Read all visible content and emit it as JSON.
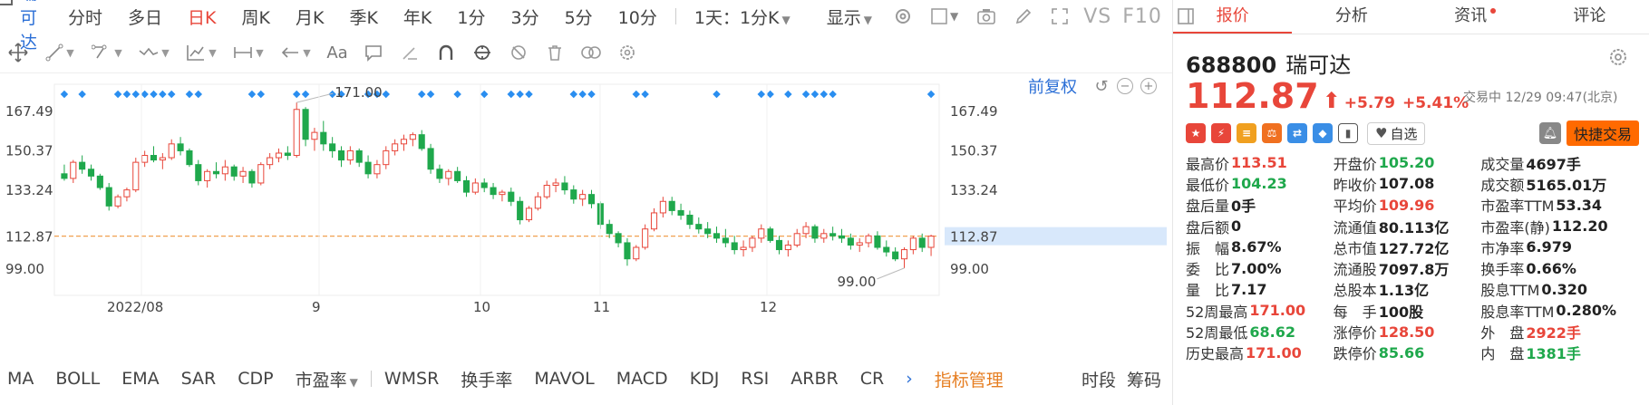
{
  "topbar": {
    "stock_name": "瑞可达",
    "timeframes": [
      {
        "label": "分时",
        "active": false
      },
      {
        "label": "多日",
        "active": false
      },
      {
        "label": "日K",
        "active": true
      },
      {
        "label": "周K",
        "active": false
      },
      {
        "label": "月K",
        "active": false
      },
      {
        "label": "季K",
        "active": false
      },
      {
        "label": "年K",
        "active": false
      },
      {
        "label": "1分",
        "active": false
      },
      {
        "label": "3分",
        "active": false
      },
      {
        "label": "5分",
        "active": false
      },
      {
        "label": "10分",
        "active": false
      }
    ],
    "range_select": "1天：1分K",
    "display_label": "显示",
    "vs_label": "VS",
    "f10_label": "F10"
  },
  "chart": {
    "adjust_label": "前复权",
    "date_labels": [
      "2022/08",
      "9",
      "10",
      "11",
      "12"
    ],
    "y_ticks": [
      "167.49",
      "150.37",
      "133.24",
      "112.87",
      "99.00"
    ],
    "y_ticks_right": [
      "167.49",
      "150.37",
      "133.24",
      "112.87",
      "99.00"
    ],
    "high_annotation": "171.00",
    "low_annotation": "99.00",
    "current_price_label": "112.87"
  },
  "chart_data": {
    "type": "candlestick",
    "ylim": [
      90,
      180
    ],
    "current_price": 112.87,
    "high": 171.0,
    "low": 99.0,
    "x_labels": [
      "2022/08",
      "9",
      "10",
      "11",
      "12"
    ],
    "candles": [
      [
        140,
        144,
        137,
        138
      ],
      [
        138,
        146,
        136,
        145
      ],
      [
        145,
        148,
        140,
        142
      ],
      [
        142,
        144,
        137,
        139
      ],
      [
        139,
        140,
        133,
        134
      ],
      [
        134,
        136,
        124,
        126
      ],
      [
        126,
        131,
        125,
        130
      ],
      [
        130,
        134,
        128,
        133
      ],
      [
        133,
        147,
        132,
        145
      ],
      [
        145,
        150,
        143,
        148
      ],
      [
        148,
        152,
        145,
        146
      ],
      [
        146,
        149,
        142,
        147
      ],
      [
        147,
        155,
        146,
        153
      ],
      [
        153,
        156,
        148,
        150
      ],
      [
        150,
        151,
        143,
        144
      ],
      [
        144,
        146,
        135,
        137
      ],
      [
        137,
        142,
        134,
        141
      ],
      [
        141,
        145,
        138,
        140
      ],
      [
        140,
        146,
        137,
        143
      ],
      [
        143,
        144,
        137,
        139
      ],
      [
        139,
        143,
        136,
        141
      ],
      [
        141,
        142,
        134,
        136
      ],
      [
        136,
        145,
        135,
        144
      ],
      [
        144,
        149,
        142,
        147
      ],
      [
        147,
        151,
        145,
        149
      ],
      [
        149,
        152,
        146,
        148
      ],
      [
        148,
        171,
        147,
        168
      ],
      [
        168,
        169,
        152,
        155
      ],
      [
        155,
        160,
        150,
        158
      ],
      [
        158,
        163,
        150,
        153
      ],
      [
        153,
        156,
        147,
        150
      ],
      [
        150,
        152,
        143,
        146
      ],
      [
        146,
        152,
        144,
        150
      ],
      [
        150,
        151,
        143,
        145
      ],
      [
        145,
        148,
        138,
        140
      ],
      [
        140,
        146,
        138,
        144
      ],
      [
        144,
        152,
        142,
        150
      ],
      [
        150,
        155,
        148,
        153
      ],
      [
        153,
        157,
        150,
        155
      ],
      [
        155,
        158,
        152,
        157
      ],
      [
        157,
        159,
        150,
        151
      ],
      [
        151,
        153,
        140,
        142
      ],
      [
        142,
        144,
        136,
        138
      ],
      [
        138,
        142,
        135,
        141
      ],
      [
        141,
        143,
        136,
        137
      ],
      [
        137,
        139,
        130,
        132
      ],
      [
        132,
        138,
        131,
        136
      ],
      [
        136,
        138,
        132,
        134
      ],
      [
        134,
        136,
        129,
        131
      ],
      [
        131,
        133,
        128,
        132
      ],
      [
        132,
        134,
        126,
        128
      ],
      [
        128,
        130,
        118,
        120
      ],
      [
        120,
        126,
        119,
        125
      ],
      [
        125,
        132,
        124,
        130
      ],
      [
        130,
        137,
        129,
        135
      ],
      [
        135,
        138,
        132,
        136
      ],
      [
        136,
        139,
        131,
        133
      ],
      [
        133,
        135,
        127,
        129
      ],
      [
        129,
        133,
        126,
        131
      ],
      [
        131,
        133,
        125,
        127
      ],
      [
        127,
        128,
        116,
        118
      ],
      [
        118,
        120,
        112,
        114
      ],
      [
        114,
        115,
        108,
        110
      ],
      [
        110,
        112,
        100,
        103
      ],
      [
        103,
        109,
        102,
        108
      ],
      [
        108,
        118,
        107,
        116
      ],
      [
        116,
        125,
        115,
        123
      ],
      [
        123,
        130,
        121,
        128
      ],
      [
        128,
        130,
        122,
        124
      ],
      [
        124,
        127,
        120,
        122
      ],
      [
        122,
        124,
        116,
        118
      ],
      [
        118,
        121,
        114,
        116
      ],
      [
        116,
        119,
        112,
        114
      ],
      [
        114,
        117,
        110,
        112
      ],
      [
        112,
        116,
        108,
        110
      ],
      [
        110,
        113,
        105,
        107
      ],
      [
        107,
        111,
        104,
        108
      ],
      [
        108,
        113,
        106,
        112
      ],
      [
        112,
        118,
        110,
        116
      ],
      [
        116,
        117,
        110,
        111
      ],
      [
        111,
        113,
        105,
        107
      ],
      [
        107,
        111,
        104,
        109
      ],
      [
        109,
        116,
        108,
        114
      ],
      [
        114,
        119,
        112,
        117
      ],
      [
        117,
        118,
        110,
        112
      ],
      [
        112,
        116,
        110,
        114
      ],
      [
        114,
        117,
        111,
        113
      ],
      [
        113,
        116,
        110,
        112
      ],
      [
        112,
        114,
        107,
        109
      ],
      [
        109,
        112,
        106,
        110
      ],
      [
        110,
        114,
        108,
        113
      ],
      [
        113,
        115,
        107,
        108
      ],
      [
        108,
        111,
        104,
        106
      ],
      [
        106,
        108,
        102,
        103
      ],
      [
        103,
        108,
        99,
        107
      ],
      [
        107,
        113,
        105,
        112
      ],
      [
        112,
        114,
        106,
        108
      ],
      [
        108,
        113.51,
        104.23,
        112.87
      ]
    ]
  },
  "drawing_tools": [
    "move-tool",
    "line-tool",
    "channel-tool",
    "wave-tool",
    "fib-tool",
    "measure-tool",
    "arrow-tool",
    "text-tool",
    "note-tool",
    "pen-tool",
    "magnet-tool",
    "sync-tool",
    "hide-tool",
    "delete-tool",
    "compare-tool",
    "settings-tool"
  ],
  "indicators": {
    "items": [
      "MA",
      "BOLL",
      "EMA",
      "SAR",
      "CDP",
      "市盈率",
      "WMSR",
      "换手率",
      "MAVOL",
      "MACD",
      "KDJ",
      "RSI",
      "ARBR",
      "CR"
    ],
    "manager": "指标管理",
    "right": [
      "时段",
      "筹码"
    ]
  },
  "panel": {
    "tabs": [
      {
        "label": "报价",
        "active": true
      },
      {
        "label": "分析",
        "active": false
      },
      {
        "label": "资讯",
        "active": false,
        "dot": true
      },
      {
        "label": "评论",
        "active": false
      }
    ],
    "code": "688800",
    "name": "瑞可达",
    "price": "112.87",
    "change": "+5.79",
    "change_pct": "+5.41%",
    "status": "交易中 12/29 09:47(北京)",
    "fav_label": "自选",
    "quick_trade": "快捷交易",
    "stats": [
      [
        {
          "l": "最高价",
          "v": "113.51",
          "c": "up"
        },
        {
          "l": "开盘价",
          "v": "105.20",
          "c": "dn"
        },
        {
          "l": "成交量",
          "v": "4697手",
          "c": ""
        }
      ],
      [
        {
          "l": "最低价",
          "v": "104.23",
          "c": "dn"
        },
        {
          "l": "昨收价",
          "v": "107.08",
          "c": ""
        },
        {
          "l": "成交额",
          "v": "5165.01万",
          "c": ""
        }
      ],
      [
        {
          "l": "盘后量",
          "v": "0手",
          "c": ""
        },
        {
          "l": "平均价",
          "v": "109.96",
          "c": "up"
        },
        {
          "l": "市盈率TTM",
          "v": "53.34",
          "c": ""
        }
      ],
      [
        {
          "l": "盘后额",
          "v": "0",
          "c": ""
        },
        {
          "l": "流通值",
          "v": "80.113亿",
          "c": ""
        },
        {
          "l": "市盈率(静)",
          "v": "112.20",
          "c": ""
        }
      ],
      [
        {
          "l": "振　幅",
          "v": "8.67%",
          "c": ""
        },
        {
          "l": "总市值",
          "v": "127.72亿",
          "c": ""
        },
        {
          "l": "市净率",
          "v": "6.979",
          "c": ""
        }
      ],
      [
        {
          "l": "委　比",
          "v": "7.00%",
          "c": ""
        },
        {
          "l": "流通股",
          "v": "7097.8万",
          "c": ""
        },
        {
          "l": "换手率",
          "v": "0.66%",
          "c": ""
        }
      ],
      [
        {
          "l": "量　比",
          "v": "7.17",
          "c": ""
        },
        {
          "l": "总股本",
          "v": "1.13亿",
          "c": ""
        },
        {
          "l": "股息TTM",
          "v": "0.320",
          "c": ""
        }
      ],
      [
        {
          "l": "52周最高",
          "v": "171.00",
          "c": "up"
        },
        {
          "l": "每　手",
          "v": "100股",
          "c": ""
        },
        {
          "l": "股息率TTM",
          "v": "0.280%",
          "c": ""
        }
      ],
      [
        {
          "l": "52周最低",
          "v": "68.62",
          "c": "dn"
        },
        {
          "l": "涨停价",
          "v": "128.50",
          "c": "up"
        },
        {
          "l": "外　盘",
          "v": "2922手",
          "c": "up"
        }
      ],
      [
        {
          "l": "历史最高",
          "v": "171.00",
          "c": "up"
        },
        {
          "l": "跌停价",
          "v": "85.66",
          "c": "dn"
        },
        {
          "l": "内　盘",
          "v": "1381手",
          "c": "dn"
        }
      ]
    ]
  },
  "colors": {
    "up": "#e8463a",
    "down": "#1fa84c",
    "accent": "#2a6ed6",
    "orange": "#ff6a00"
  }
}
